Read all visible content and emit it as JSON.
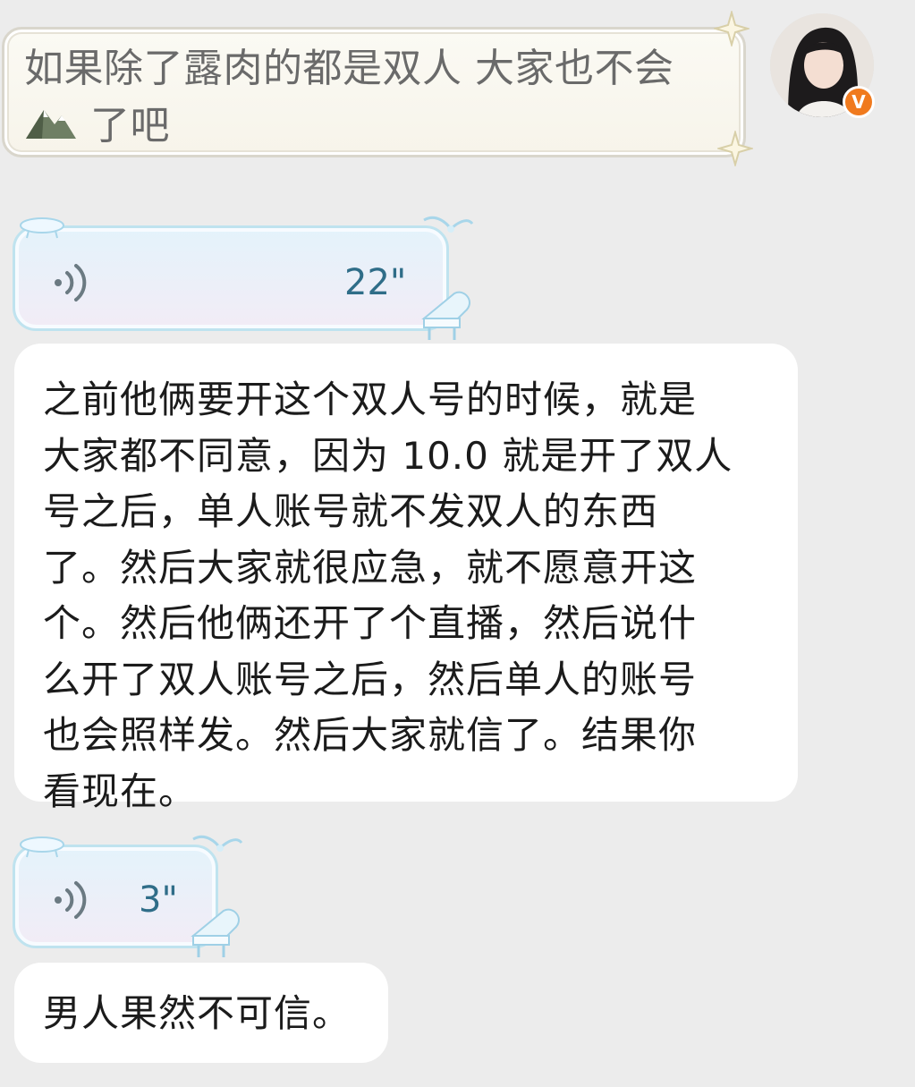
{
  "messages": {
    "outgoing_text": "如果除了露肉的都是双人 大家也不会",
    "outgoing_text_line2": "了吧",
    "outgoing_emoji": "mountain-emoji",
    "voice1": {
      "duration": "22\""
    },
    "incoming_text_lines": [
      "之前他俩要开这个双人号的时候，就是",
      "大家都不同意，因为 10.0 就是开了双人",
      "号之后，单人账号就不发双人的东西",
      "了。然后大家就很应急，就不愿意开这",
      "个。然后他俩还开了个直播，然后说什",
      "么开了双人账号之后，然后单人的账号",
      "也会照样发。然后大家就信了。结果你",
      "看现在。"
    ],
    "voice2": {
      "duration": "3\""
    },
    "incoming_text2": "男人果然不可信。"
  },
  "avatar": {
    "badge": "V",
    "badge_color": "#f07a1e"
  },
  "colors": {
    "background": "#ececec",
    "voice_text": "#2f6d88"
  }
}
